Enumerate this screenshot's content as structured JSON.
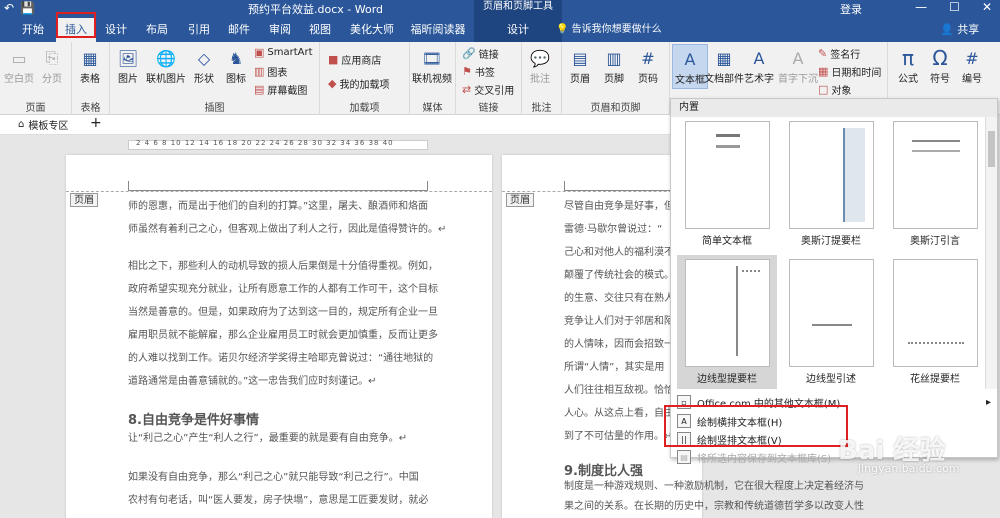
{
  "titlebar": {
    "doc_title": "预约平台效益.docx - Word",
    "context_group": "页眉和页脚工具",
    "login": "登录",
    "qat_undo": "↶",
    "qat_save": "💾",
    "win_min": "—",
    "win_max": "☐",
    "win_close": "✕"
  },
  "tabs": [
    {
      "label": "开始"
    },
    {
      "label": "插入"
    },
    {
      "label": "设计"
    },
    {
      "label": "布局"
    },
    {
      "label": "引用"
    },
    {
      "label": "邮件"
    },
    {
      "label": "审阅"
    },
    {
      "label": "视图"
    },
    {
      "label": "美化大师"
    },
    {
      "label": "福昕阅读器"
    },
    {
      "label": "设计"
    }
  ],
  "tellme": "告诉我你想要做什么",
  "share": "共享",
  "ribbon": {
    "pages_group": "页面",
    "blank_page": "空白页",
    "page_break": "分页",
    "table_group": "表格",
    "table": "表格",
    "illus_group": "插图",
    "picture": "图片",
    "online_picture": "联机图片",
    "shapes": "形状",
    "icons": "图标",
    "smartart": "SmartArt",
    "chart": "图表",
    "screenshot": "屏幕截图",
    "addins_group": "加载项",
    "store": "应用商店",
    "my_addins": "我的加载项",
    "media_group": "媒体",
    "online_video": "联机视频",
    "links_group": "链接",
    "link": "链接",
    "bookmark": "书签",
    "crossref": "交叉引用",
    "comments_group": "批注",
    "comment": "批注",
    "hf_group": "页眉和页脚",
    "header": "页眉",
    "footer": "页脚",
    "page_number": "页码",
    "textbox": "文本框",
    "quickparts": "文档部件",
    "wordart": "艺术字",
    "dropcap": "首字下沉",
    "signature": "签名行",
    "datetime": "日期和时间",
    "object": "对象",
    "formula": "公式",
    "symbol": "符号",
    "number": "编号"
  },
  "doctab": {
    "label": "模板专区",
    "plus": "+"
  },
  "ruler_numbers": "2  4  6  8  10  12  14  16  18  20  22  24  26  28  30  32  34  36  38  40",
  "page1": {
    "header_label": "页眉",
    "paragraphs": [
      "师的恩惠，而是出于他们的自利的打算。”这里，屠夫、酿酒师和烙面",
      "师虽然有着利己之心，但客观上做出了利人之行，因此是值得赞许的。↵",
      "相比之下，那些利人的动机导致的损人后果倒是十分值得重视。例如，",
      "政府希望实现充分就业，让所有愿意工作的人都有工作可干，这个目标",
      "当然是善意的。但是，如果政府为了达到这一目的，规定所有企业一旦",
      "雇用职员就不能解雇，那么企业雇用员工时就会更加慎重，反而让更多",
      "的人难以找到工作。诺贝尔经济学奖得主哈耶克曾说过：“通往地狱的",
      "道路通常是由善意铺就的。”这一忠告我们应时刻谨记。↵"
    ],
    "heading": "8.自由竞争是件好事情",
    "sub": "让“利己之心”产生“利人之行”，最重要的就是要有自由竞争。↵",
    "paragraphs2": [
      "如果没有自由竞争，那么“利己之心”就只能导致“利己之行”。中国",
      "农村有句老话，叫“医人要发，房子快塌”，意思是工匠要发财，就必"
    ]
  },
  "page2": {
    "header_label": "页眉",
    "lines": [
      "尽管自由竞争是好事，但",
      "雷德·马歇尔曾说过：“",
      "己心和对他人的福利漠不",
      "颠覆了传统社会的模式。",
      "的生意、交往只有在熟人",
      "竞争让人们对于邻居和陌",
      "的人情味，因而会招致一",
      "所谓“人情”，其实是用",
      "人们往往相互敌视。恰恰",
      "人心。从这点上看，自由",
      "到了不可估量的作用。↵"
    ],
    "heading": "9.制度比人强",
    "lines2": [
      "制度是一种游戏规则、一种激励机制，它在很大程度上决定着经济与各",
      "果之间的关系。在长期的历史中，宗教和传统道德哲学多以改变人性为"
    ]
  },
  "panel": {
    "title": "内置",
    "items": [
      {
        "caption": "简单文本框"
      },
      {
        "caption": "奥斯汀提要栏"
      },
      {
        "caption": "奥斯汀引言"
      },
      {
        "caption": "边线型提要栏"
      },
      {
        "caption": "边线型引述"
      },
      {
        "caption": "花丝提要栏"
      }
    ],
    "menu": [
      {
        "label": "Office.com 中的其他文本框(M)",
        "arrow": "▸"
      },
      {
        "label": "绘制横排文本框(H)"
      },
      {
        "label": "绘制竖排文本框(V)"
      },
      {
        "label": "将所选内容保存到文本框库(S)"
      }
    ]
  },
  "watermark": {
    "text": "Bai 经验",
    "sub": "jingyan.baidu.com"
  }
}
